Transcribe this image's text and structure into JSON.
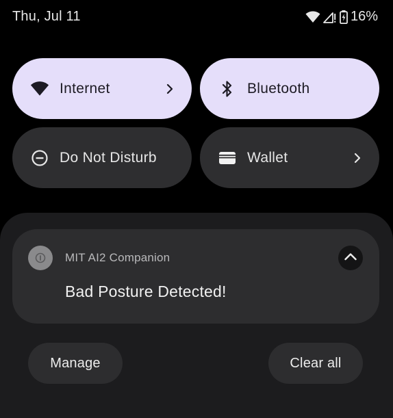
{
  "status_bar": {
    "date": "Thu, Jul 11",
    "battery_percent": "16%",
    "icons": [
      "wifi-icon",
      "cellular-signal-icon",
      "battery-charging-icon"
    ]
  },
  "quick_settings": {
    "tiles": [
      {
        "label": "Internet",
        "icon": "wifi-icon",
        "state": "on",
        "has_chevron": true
      },
      {
        "label": "Bluetooth",
        "icon": "bluetooth-icon",
        "state": "on",
        "has_chevron": false
      },
      {
        "label": "Do Not Disturb",
        "icon": "do-not-disturb-icon",
        "state": "off",
        "has_chevron": false
      },
      {
        "label": "Wallet",
        "icon": "wallet-icon",
        "state": "off",
        "has_chevron": true
      }
    ]
  },
  "notification": {
    "app_name": "MIT AI2 Companion",
    "title": "Bad Posture Detected!",
    "app_icon": "info-icon",
    "expand_icon": "chevron-up-icon"
  },
  "actions": {
    "manage_label": "Manage",
    "clear_all_label": "Clear all"
  },
  "colors": {
    "background": "#000000",
    "tile_active": "#e5defa",
    "tile_inactive": "#2e2e30",
    "shade": "#1c1c1e",
    "notification_card": "#2d2d2f"
  }
}
